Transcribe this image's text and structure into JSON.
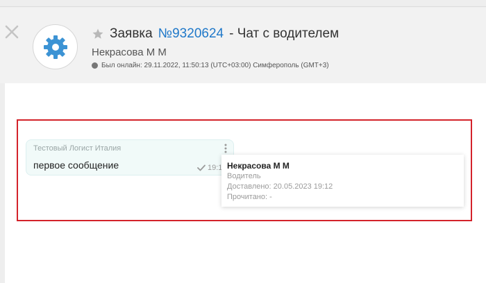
{
  "header": {
    "title_prefix": "Заявка",
    "order_number": "№9320624",
    "title_suffix": "- Чат с водителем",
    "driver_name": "Некрасова М М",
    "status_text": "Был онлайн: 29.11.2022, 11:50:13 (UTC+03:00) Симферополь (GMT+3)",
    "icons": {
      "close": "close-icon",
      "avatar": "gear-icon",
      "favorite": "star-icon",
      "status": "status-dot-icon"
    }
  },
  "messages": [
    {
      "author": "Тестовый Логист Италия",
      "text": "первое сообщение",
      "time": "19:1",
      "icons": {
        "menu": "kebab-menu-icon",
        "status": "check-icon"
      }
    }
  ],
  "tooltip": {
    "name": "Некрасова М М",
    "role": "Водитель",
    "delivered": "Доставлено: 20.05.2023 19:12",
    "read": "Прочитано: -"
  },
  "colors": {
    "accent": "#1f78c9",
    "avatar_icon": "#3c93d4",
    "highlight": "#d3222a",
    "bubble": "#f1faf9"
  }
}
